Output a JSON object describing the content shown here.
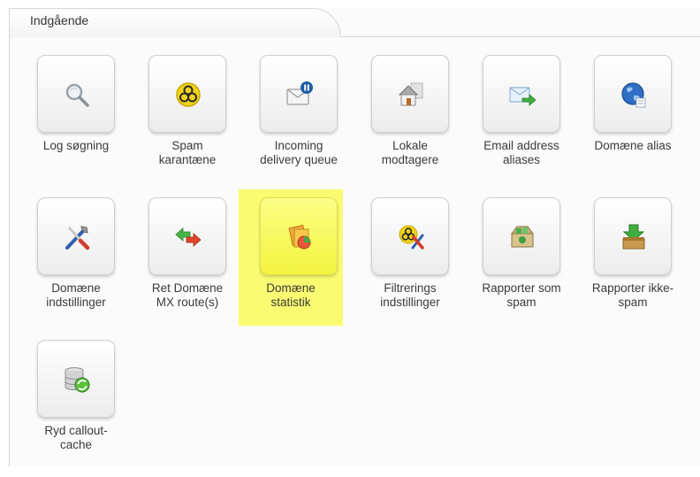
{
  "panel": {
    "title": "Indgående"
  },
  "tiles": [
    {
      "label": "Log søgning",
      "icon": "magnifier-icon"
    },
    {
      "label": "Spam\nkarantæne",
      "icon": "biohazard-icon"
    },
    {
      "label": "Incoming\ndelivery queue",
      "icon": "envelope-pause-icon"
    },
    {
      "label": "Lokale\nmodtagere",
      "icon": "house-icon"
    },
    {
      "label": "Email address\naliases",
      "icon": "envelope-forward-icon"
    },
    {
      "label": "Domæne alias",
      "icon": "globe-icon"
    },
    {
      "label": "Domæne\nindstillinger",
      "icon": "tools-icon"
    },
    {
      "label": "Ret Domæne\nMX route(s)",
      "icon": "bidirectional-arrows-icon"
    },
    {
      "label": "Domæne\nstatistik",
      "icon": "statistics-icon",
      "selected": true
    },
    {
      "label": "Filtrerings\nindstillinger",
      "icon": "biohazard-tools-icon"
    },
    {
      "label": "Rapporter som\nspam",
      "icon": "report-spam-icon"
    },
    {
      "label": "Rapporter ikke-\nspam",
      "icon": "report-not-spam-icon"
    },
    {
      "label": "Ryd callout-\ncache",
      "icon": "database-refresh-icon"
    }
  ]
}
